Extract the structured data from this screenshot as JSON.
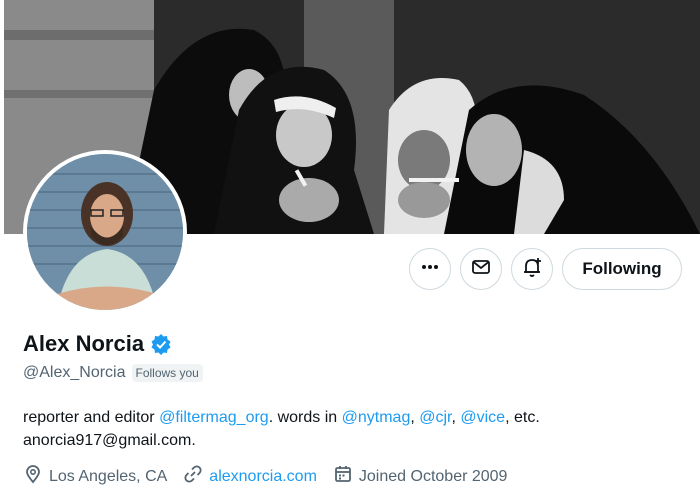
{
  "profile": {
    "name": "Alex Norcia",
    "handle": "@Alex_Norcia",
    "follows_you": "Follows you",
    "bio": {
      "part1": "reporter and editor ",
      "mention1": "@filtermag_org",
      "part2": ". words in ",
      "mention2": "@nytmag",
      "sep1": ", ",
      "mention3": "@cjr",
      "sep2": ", ",
      "mention4": "@vice",
      "part3": ", etc.",
      "line2": "anorcia917@gmail.com."
    },
    "location": "Los Angeles, CA",
    "website": "alexnorcia.com",
    "joined": "Joined October 2009"
  },
  "actions": {
    "follow_label": "Following"
  },
  "colors": {
    "accent": "#1d9bf0",
    "text": "#0f1419",
    "muted": "#536471",
    "border": "#cfd9de"
  },
  "icons": [
    "more-icon",
    "mail-icon",
    "notification-bell-icon",
    "verified-badge-icon",
    "location-icon",
    "link-icon",
    "calendar-icon"
  ]
}
